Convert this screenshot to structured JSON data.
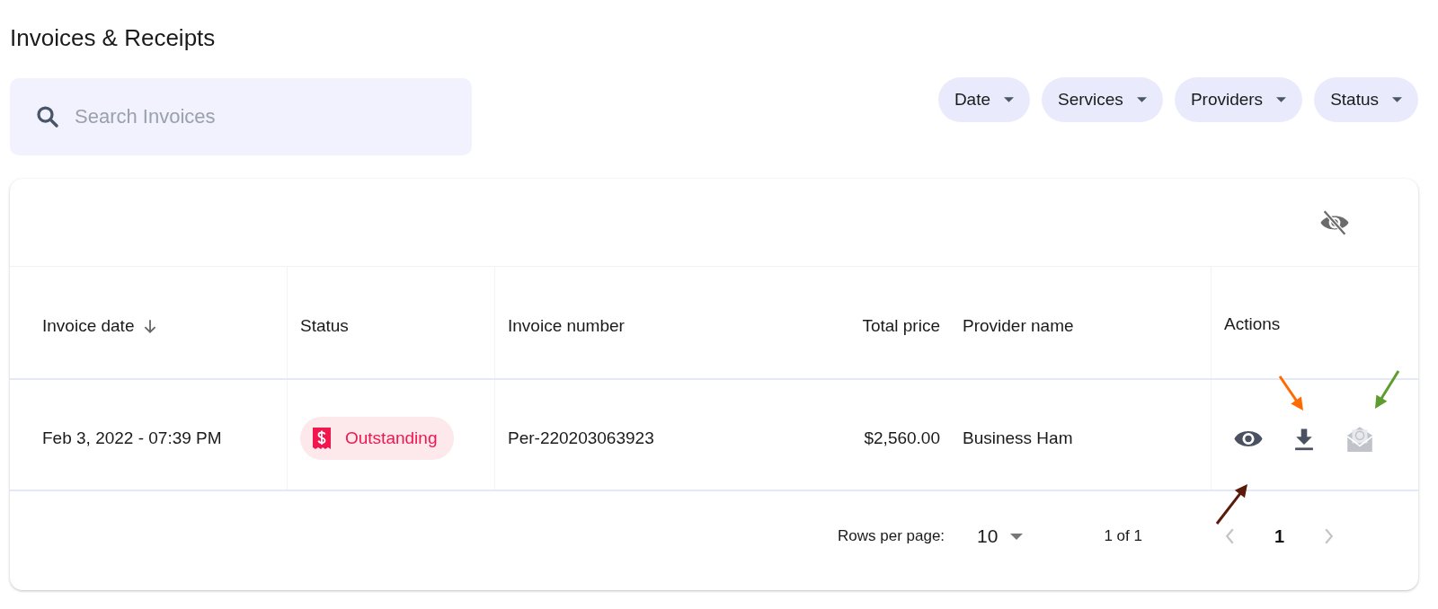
{
  "page": {
    "title": "Invoices & Receipts"
  },
  "search": {
    "placeholder": "Search Invoices"
  },
  "filters": [
    {
      "label": "Date"
    },
    {
      "label": "Services"
    },
    {
      "label": "Providers"
    },
    {
      "label": "Status"
    }
  ],
  "table": {
    "columns": [
      {
        "label": "Invoice date",
        "sorted": true
      },
      {
        "label": "Status",
        "sorted": false
      },
      {
        "label": "Invoice number",
        "sorted": false
      },
      {
        "label": "Total price",
        "sorted": false
      },
      {
        "label": "Provider name",
        "sorted": false
      },
      {
        "label": "Actions",
        "sorted": false
      }
    ],
    "rows": [
      {
        "invoice_date": "Feb 3, 2022 - 07:39 PM",
        "status": {
          "label": "Outstanding",
          "kind": "outstanding"
        },
        "invoice_number": "Per-220203063923",
        "total_price": "$2,560.00",
        "provider_name": "Business Ham",
        "actions": [
          {
            "kind": "view",
            "disabled": false,
            "arrow": {
              "color": "#5c1a0b"
            }
          },
          {
            "kind": "download",
            "disabled": false,
            "arrow": {
              "color": "#ff6a00"
            }
          },
          {
            "kind": "send",
            "disabled": true,
            "arrow": {
              "color": "#5e9c2f"
            }
          }
        ]
      }
    ]
  },
  "pagination": {
    "rows_per_page_label": "Rows per page:",
    "rows_per_page": "10",
    "range": "1 of 1",
    "prev_disabled": true,
    "next_disabled": true,
    "pages": [
      {
        "label": "1",
        "selected": true
      }
    ]
  }
}
